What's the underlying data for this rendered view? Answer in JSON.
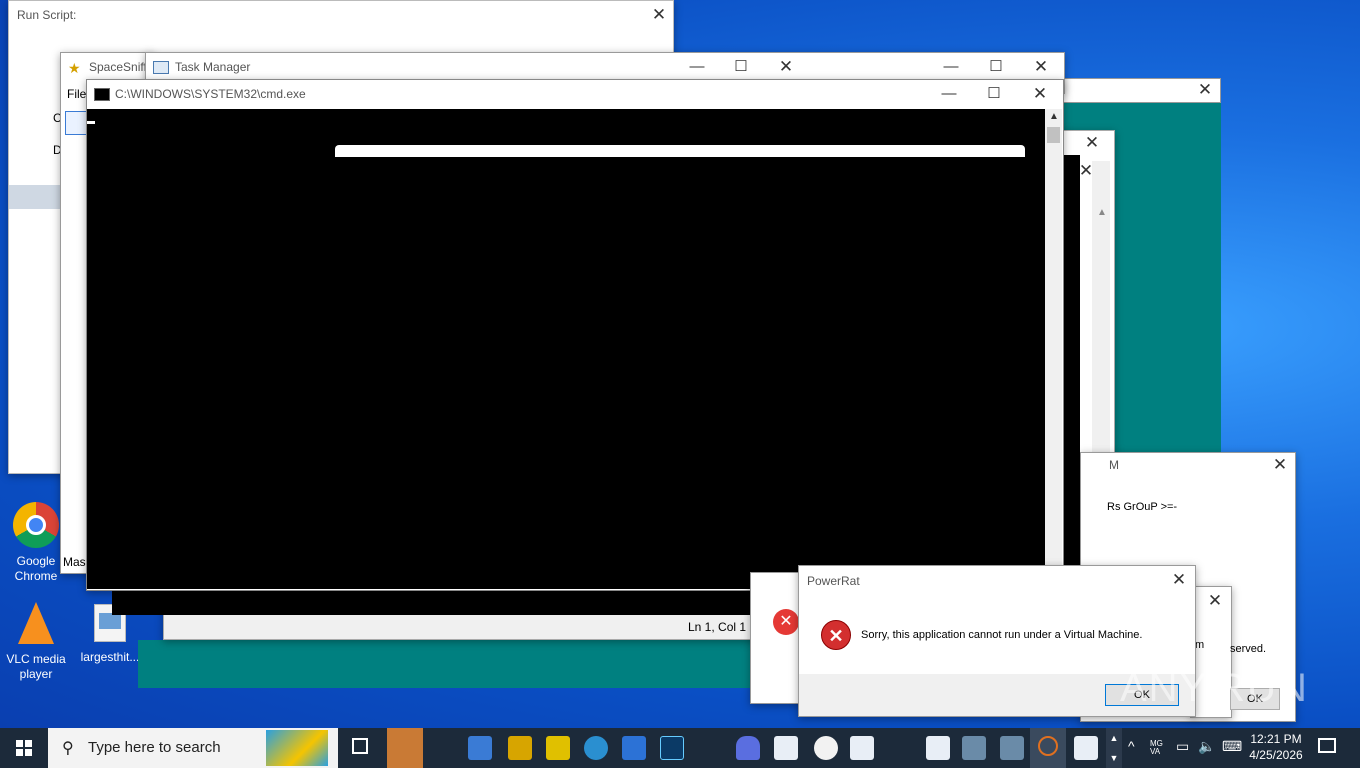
{
  "windows": {
    "run_script": {
      "title": "Run Script:",
      "menu_fragments": [
        "C",
        "D"
      ]
    },
    "spacesniffer": {
      "title": "SpaceSniff",
      "menu_file": "File",
      "statusbar_fragment": "Mas"
    },
    "task_manager": {
      "title": "Task Manager"
    },
    "cmd": {
      "title": "C:\\WINDOWS\\SYSTEM32\\cmd.exe"
    },
    "notepad": {
      "status": "Ln 1, Col 1"
    },
    "background_dialog": {
      "title_fragment": "M",
      "text_fragment": "Rs GrOuP >=-",
      "line2_fragment": "m",
      "line3_fragment": "served.",
      "ok_label": "OK"
    },
    "powerrat": {
      "title": "PowerRat",
      "message": "Sorry, this application cannot run under a Virtual Machine.",
      "ok_label": "OK"
    }
  },
  "desktop_icons": [
    {
      "label": "Google Chrome",
      "icon": "chrome-icon"
    },
    {
      "label": "VLC media player",
      "icon": "vlc-icon"
    },
    {
      "label": "largesthit...",
      "icon": "image-file-icon"
    }
  ],
  "taskbar": {
    "search_placeholder": "Type here to search",
    "time": "12:21 PM",
    "date": "4/25/2026"
  },
  "watermark": "ANY.RUN"
}
